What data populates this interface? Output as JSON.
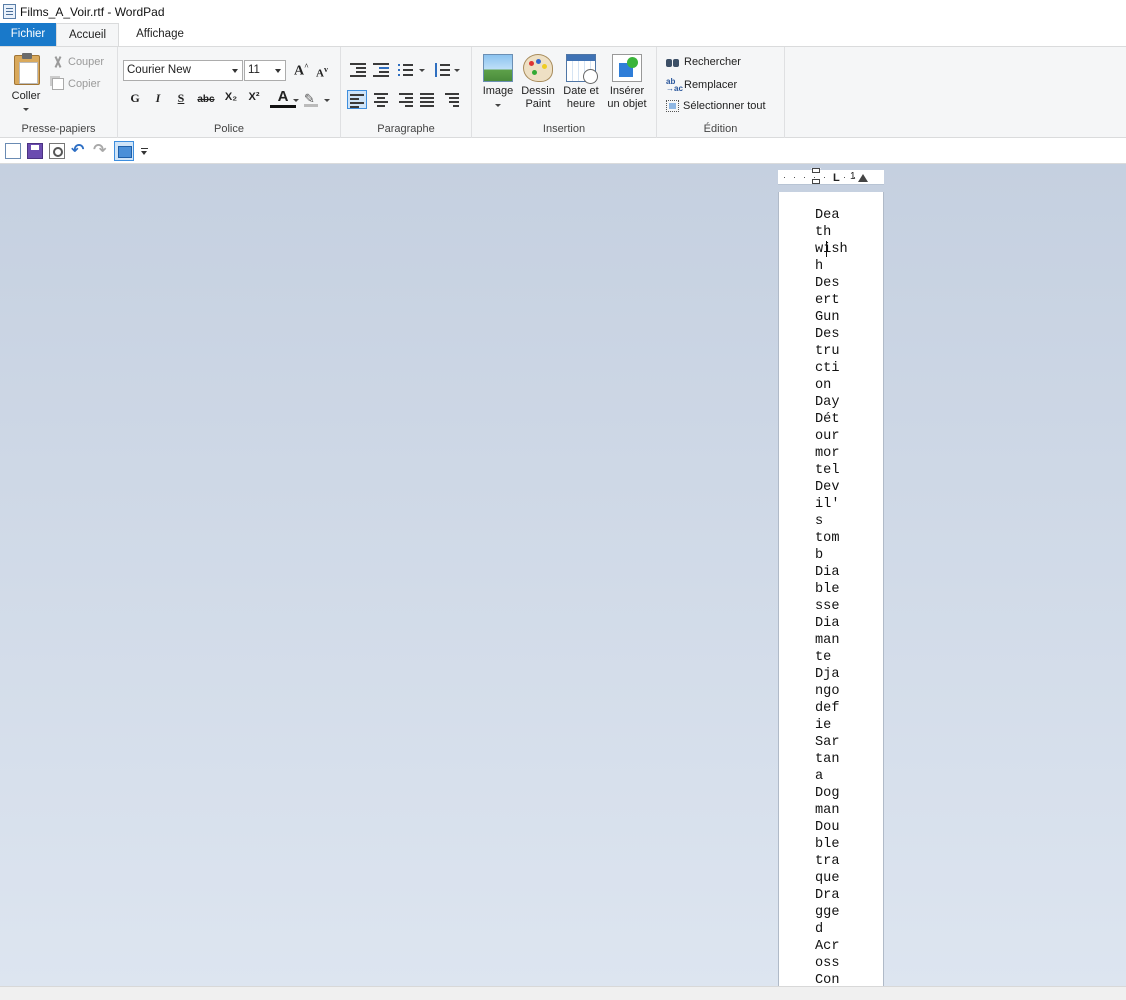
{
  "window": {
    "title": "Films_A_Voir.rtf - WordPad"
  },
  "tabs": {
    "file": "Fichier",
    "home": "Accueil",
    "view": "Affichage"
  },
  "ribbon": {
    "clipboard": {
      "paste": "Coller",
      "cut": "Couper",
      "copy": "Copier",
      "group": "Presse-papiers"
    },
    "font": {
      "name": "Courier New",
      "size": "11",
      "group": "Police",
      "bold": "G",
      "italic": "I",
      "underline": "S",
      "strike": "abc",
      "grow": "A",
      "shrink": "A",
      "subscript": "X₂",
      "superscript": "X²",
      "color": "A"
    },
    "paragraph": {
      "group": "Paragraphe"
    },
    "insert": {
      "image": "Image",
      "paint1": "Dessin",
      "paint2": "Paint",
      "date1": "Date et",
      "date2": "heure",
      "object1": "Insérer",
      "object2": "un objet",
      "group": "Insertion"
    },
    "edit": {
      "find": "Rechercher",
      "replace": "Remplacer",
      "select_all": "Sélectionner tout",
      "group": "Édition"
    }
  },
  "ruler": {
    "tab_marker": "L",
    "number": "1"
  },
  "document": {
    "text": "Dea\nth\nwish\nh\nDes\nert\nGun\nDes\ntru\ncti\non\nDay\nDét\nour\nmor\ntel\nDev\nil'\ns\ntom\nb\nDia\nble\nsse\nDia\nman\nte\nDja\nngo\ndef\nie\nSar\ntan\na\nDog\nman\nDou\nble\ntra\nque\nDra\ngge\nd\nAcr\noss\nCon"
  }
}
